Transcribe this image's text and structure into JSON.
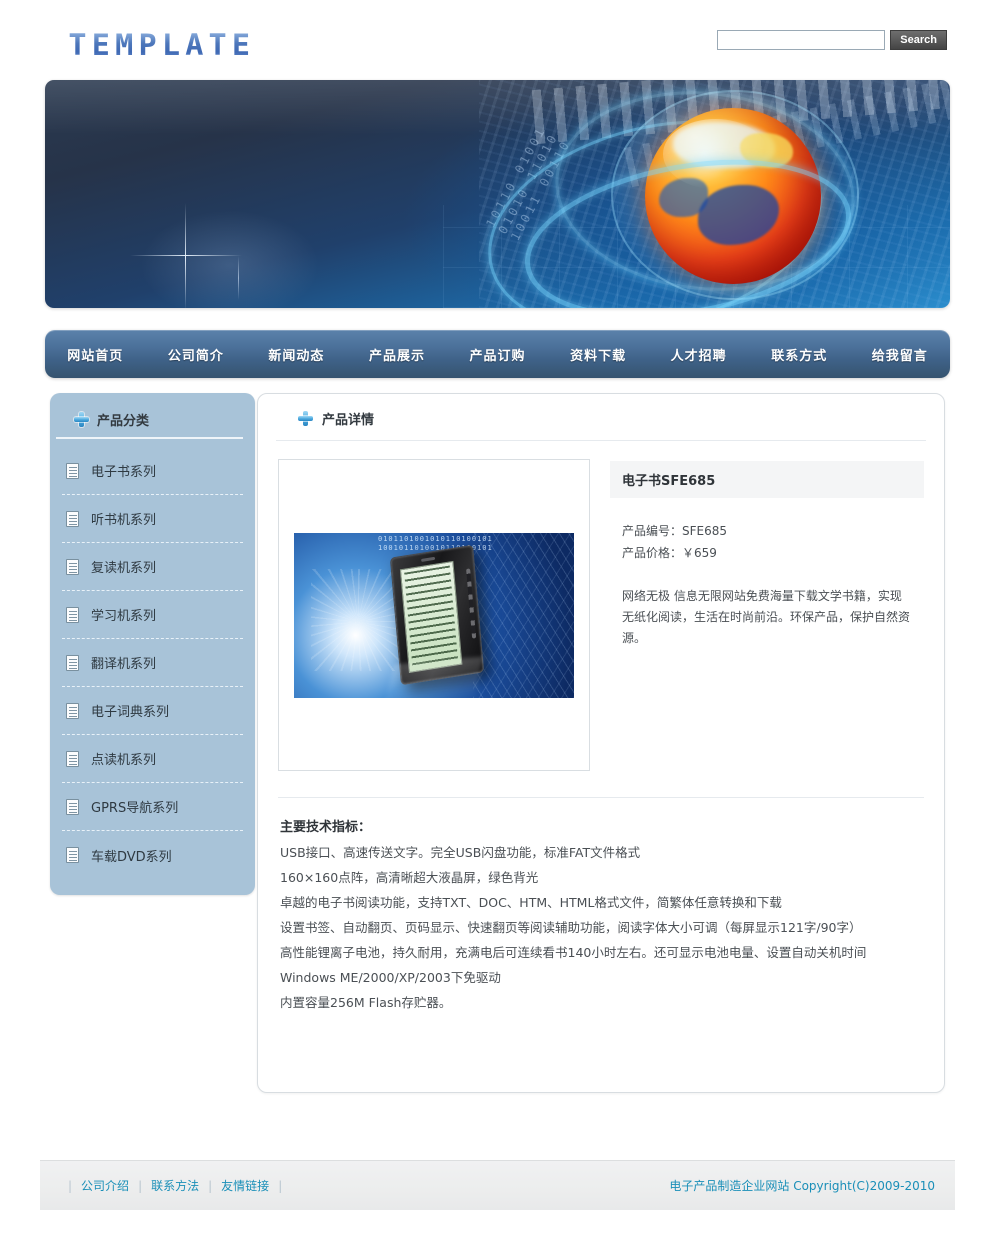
{
  "header": {
    "logo_text": "TEMPLATE",
    "search": {
      "value": "",
      "placeholder": "",
      "button_label": "Search"
    }
  },
  "nav": {
    "items": [
      {
        "label": "网站首页"
      },
      {
        "label": "公司简介"
      },
      {
        "label": "新闻动态"
      },
      {
        "label": "产品展示"
      },
      {
        "label": "产品订购"
      },
      {
        "label": "资料下载"
      },
      {
        "label": "人才招聘"
      },
      {
        "label": "联系方式"
      },
      {
        "label": "给我留言"
      }
    ]
  },
  "sidebar": {
    "title": "产品分类",
    "title_icon": "plus-icon",
    "items": [
      {
        "label": "电子书系列",
        "icon": "document-icon"
      },
      {
        "label": "听书机系列",
        "icon": "document-icon"
      },
      {
        "label": "复读机系列",
        "icon": "document-icon"
      },
      {
        "label": "学习机系列",
        "icon": "document-icon"
      },
      {
        "label": "翻译机系列",
        "icon": "document-icon"
      },
      {
        "label": "电子词典系列",
        "icon": "document-icon"
      },
      {
        "label": "点读机系列",
        "icon": "document-icon"
      },
      {
        "label": "GPRS导航系列",
        "icon": "document-icon"
      },
      {
        "label": "车载DVD系列",
        "icon": "document-icon"
      }
    ]
  },
  "main": {
    "panel_title": "产品详情",
    "panel_title_icon": "plus-icon",
    "product": {
      "name": "电子书SFE685",
      "code_line": "产品编号：SFE685",
      "price_line": "产品价格：￥659",
      "description": "网络无极 信息无限网站免费海量下载文学书籍，实现无纸化阅读，生活在时尚前沿。环保产品，保护自然资源。",
      "image_alt": "电子书阅读器产品图片"
    },
    "specs": {
      "heading": "主要技术指标：",
      "lines": [
        "USB接口、高速传送文字。完全USB闪盘功能，标准FAT文件格式",
        "160×160点阵，高清晰超大液晶屏，绿色背光",
        "卓越的电子书阅读功能，支持TXT、DOC、HTM、HTML格式文件，简繁体任意转换和下载",
        "设置书签、自动翻页、页码显示、快速翻页等阅读辅助功能，阅读字体大小可调（每屏显示121字/90字）",
        "高性能锂离子电池，持久耐用，充满电后可连续看书140小时左右。还可显示电池电量、设置自动关机时间",
        "Windows ME/2000/XP/2003下免驱动",
        "内置容量256M Flash存贮器。"
      ]
    }
  },
  "banner": {
    "alt": "地球与光环科技横幅图片",
    "binary_text": "10110 01001\n01010 11010\n10011 00110"
  },
  "footer": {
    "links": [
      {
        "label": "公司介绍"
      },
      {
        "label": "联系方法"
      },
      {
        "label": "友情链接"
      }
    ],
    "copyright": "电子产品制造企业网站  Copyright(C)2009-2010"
  },
  "colors": {
    "nav_blue": "#4a6f98",
    "sidebar_blue": "#a8c3d8",
    "accent_cyan": "#1a8fb8",
    "logo_blue": "#4d77bb",
    "panel_border": "#d8dde1"
  }
}
